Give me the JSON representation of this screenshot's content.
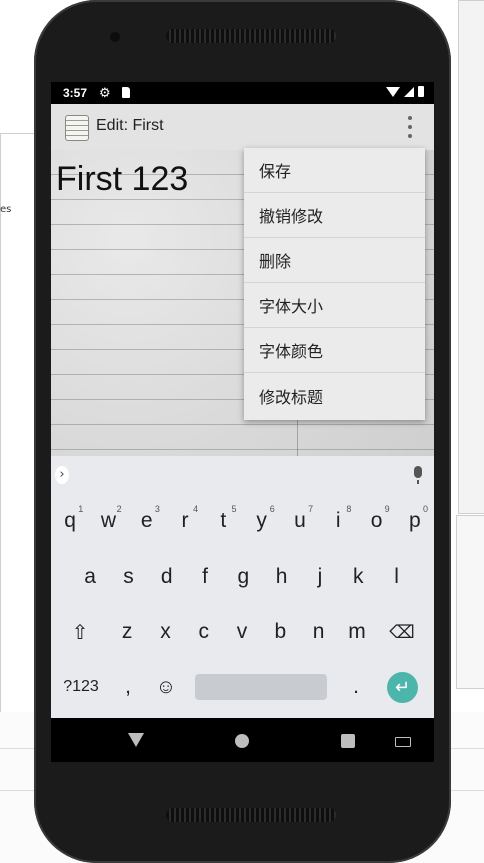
{
  "desktop": {
    "left_fragment_text": "es"
  },
  "status_bar": {
    "time": "3:57"
  },
  "app_bar": {
    "title": "Edit: First"
  },
  "note": {
    "text": "First 123"
  },
  "menu": {
    "items": [
      "保存",
      "撤销修改",
      "删除",
      "字体大小",
      "字体颜色",
      "修改标题"
    ]
  },
  "keyboard": {
    "row1": [
      {
        "key": "q",
        "hint": "1"
      },
      {
        "key": "w",
        "hint": "2"
      },
      {
        "key": "e",
        "hint": "3"
      },
      {
        "key": "r",
        "hint": "4"
      },
      {
        "key": "t",
        "hint": "5"
      },
      {
        "key": "y",
        "hint": "6"
      },
      {
        "key": "u",
        "hint": "7"
      },
      {
        "key": "i",
        "hint": "8"
      },
      {
        "key": "o",
        "hint": "9"
      },
      {
        "key": "p",
        "hint": "0"
      }
    ],
    "row2": [
      "a",
      "s",
      "d",
      "f",
      "g",
      "h",
      "j",
      "k",
      "l"
    ],
    "row3": [
      "z",
      "x",
      "c",
      "v",
      "b",
      "n",
      "m"
    ],
    "symbols_key": "?123",
    "comma": ",",
    "period": ".",
    "emoji_icon": "emoji-icon",
    "shift_icon": "shift-icon",
    "backspace_icon": "backspace-icon",
    "enter_icon": "enter-icon"
  },
  "colors": {
    "enter_key": "#4db6ac",
    "menu_bg": "#ebebeb",
    "appbar_bg": "#e3e3e3"
  }
}
